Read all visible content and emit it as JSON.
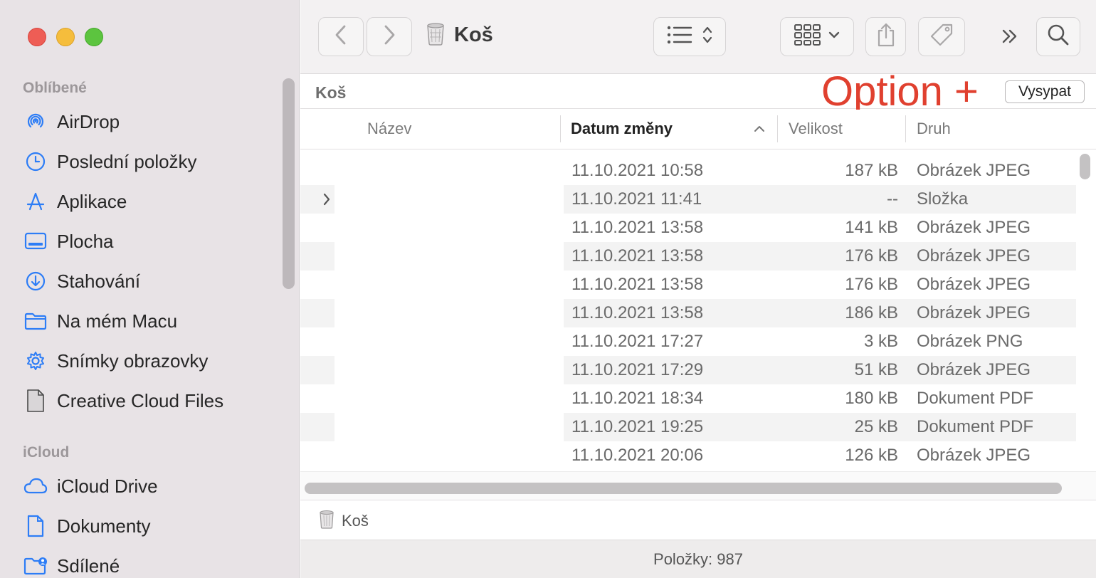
{
  "window": {
    "title": "Koš"
  },
  "sidebar": {
    "sections": [
      {
        "title": "Oblíbené",
        "items": [
          {
            "label": "AirDrop",
            "icon": "airdrop-icon"
          },
          {
            "label": "Poslední položky",
            "icon": "clock-icon"
          },
          {
            "label": "Aplikace",
            "icon": "applications-icon"
          },
          {
            "label": "Plocha",
            "icon": "desktop-icon"
          },
          {
            "label": "Stahování",
            "icon": "download-icon"
          },
          {
            "label": "Na mém Macu",
            "icon": "folder-icon"
          },
          {
            "label": "Snímky obrazovky",
            "icon": "gear-icon"
          },
          {
            "label": "Creative Cloud Files",
            "icon": "document-icon"
          }
        ]
      },
      {
        "title": "iCloud",
        "items": [
          {
            "label": "iCloud Drive",
            "icon": "cloud-icon"
          },
          {
            "label": "Dokumenty",
            "icon": "document-icon"
          },
          {
            "label": "Sdílené",
            "icon": "shared-folder-icon"
          }
        ]
      }
    ]
  },
  "toolbar": {
    "title": "Koš"
  },
  "pathbar": {
    "title": "Koš",
    "annotation": "Option +",
    "empty_button": "Vysypat"
  },
  "columns": {
    "name": "Název",
    "date": "Datum změny",
    "size": "Velikost",
    "kind": "Druh"
  },
  "rows": [
    {
      "date": "11.10.2021 10:58",
      "size": "187 kB",
      "kind": "Obrázek JPEG",
      "folder": false
    },
    {
      "date": "11.10.2021 11:41",
      "size": "--",
      "kind": "Složka",
      "folder": true
    },
    {
      "date": "11.10.2021 13:58",
      "size": "141 kB",
      "kind": "Obrázek JPEG",
      "folder": false
    },
    {
      "date": "11.10.2021 13:58",
      "size": "176 kB",
      "kind": "Obrázek JPEG",
      "folder": false
    },
    {
      "date": "11.10.2021 13:58",
      "size": "176 kB",
      "kind": "Obrázek JPEG",
      "folder": false
    },
    {
      "date": "11.10.2021 13:58",
      "size": "186 kB",
      "kind": "Obrázek JPEG",
      "folder": false
    },
    {
      "date": "11.10.2021 17:27",
      "size": "3 kB",
      "kind": "Obrázek PNG",
      "folder": false
    },
    {
      "date": "11.10.2021 17:29",
      "size": "51 kB",
      "kind": "Obrázek JPEG",
      "folder": false
    },
    {
      "date": "11.10.2021 18:34",
      "size": "180 kB",
      "kind": "Dokument PDF",
      "folder": false
    },
    {
      "date": "11.10.2021 19:25",
      "size": "25 kB",
      "kind": "Dokument PDF",
      "folder": false
    },
    {
      "date": "11.10.2021 20:06",
      "size": "126 kB",
      "kind": "Obrázek JPEG",
      "folder": false
    }
  ],
  "bottom_path": {
    "label": "Koš"
  },
  "status": {
    "text": "Položky: 987"
  },
  "colors": {
    "accent": "#2d7df6",
    "annotation": "#e0402f",
    "sidebar_bg": "#e8e3e6"
  }
}
